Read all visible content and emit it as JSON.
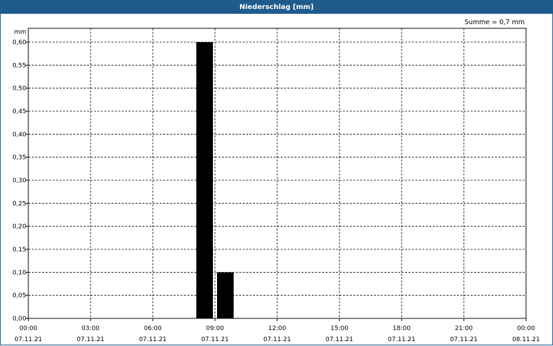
{
  "window": {
    "title": "Niederschlag [mm]"
  },
  "annotation": "Summe = 0,7 mm",
  "chart_data": {
    "type": "bar",
    "title": "Niederschlag [mm]",
    "ylabel": "mm",
    "xlabel": "",
    "ylim": [
      0,
      0.6
    ],
    "yticks": [
      "0,00",
      "0,05",
      "0,10",
      "0,15",
      "0,20",
      "0,25",
      "0,30",
      "0,35",
      "0,40",
      "0,45",
      "0,50",
      "0,55",
      "0,60"
    ],
    "xlim_hours": [
      0,
      24
    ],
    "xticks": [
      {
        "time": "00:00",
        "date": "07.11.21"
      },
      {
        "time": "03:00",
        "date": "07.11.21"
      },
      {
        "time": "06:00",
        "date": "07.11.21"
      },
      {
        "time": "09:00",
        "date": "07.11.21"
      },
      {
        "time": "12:00",
        "date": "07.11.21"
      },
      {
        "time": "15:00",
        "date": "07.11.21"
      },
      {
        "time": "18:00",
        "date": "07.11.21"
      },
      {
        "time": "21:00",
        "date": "07.11.21"
      },
      {
        "time": "00:00",
        "date": "08.11.21"
      }
    ],
    "grid": true,
    "bar_color": "#000000",
    "series": [
      {
        "values": [
          {
            "x_start": "08:00",
            "x_end": "09:00",
            "y": 0.6
          },
          {
            "x_start": "09:00",
            "x_end": "10:00",
            "y": 0.1
          }
        ]
      }
    ]
  }
}
